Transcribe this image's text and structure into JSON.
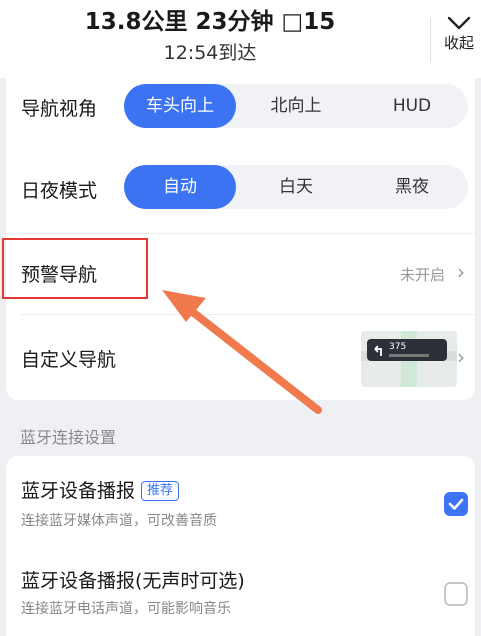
{
  "header": {
    "distance_line": "13.8公里 23分钟 □15",
    "arrival": "12:54到达",
    "collapse_label": "收起"
  },
  "nav_view": {
    "label": "导航视角",
    "options": [
      "车头向上",
      "北向上",
      "HUD"
    ],
    "selected": "车头向上"
  },
  "day_night": {
    "label": "日夜模式",
    "options": [
      "自动",
      "白天",
      "黑夜"
    ],
    "selected": "自动"
  },
  "warning_nav": {
    "label": "预警导航",
    "status": "未开启"
  },
  "custom_nav": {
    "label": "自定义导航",
    "thumb_distance": "375"
  },
  "bluetooth": {
    "section_title": "蓝牙连接设置",
    "items": [
      {
        "label": "蓝牙设备播报",
        "tag": "推荐",
        "sub": "连接蓝牙媒体声道，可改善音质",
        "checked": true
      },
      {
        "label": "蓝牙设备播报(无声时可选)",
        "sub": "连接蓝牙电话声道，可能影响音乐",
        "checked": false
      }
    ]
  },
  "colors": {
    "accent": "#3b73f3",
    "highlight_box": "#e53935",
    "annotation_arrow": "#f07a4e"
  }
}
